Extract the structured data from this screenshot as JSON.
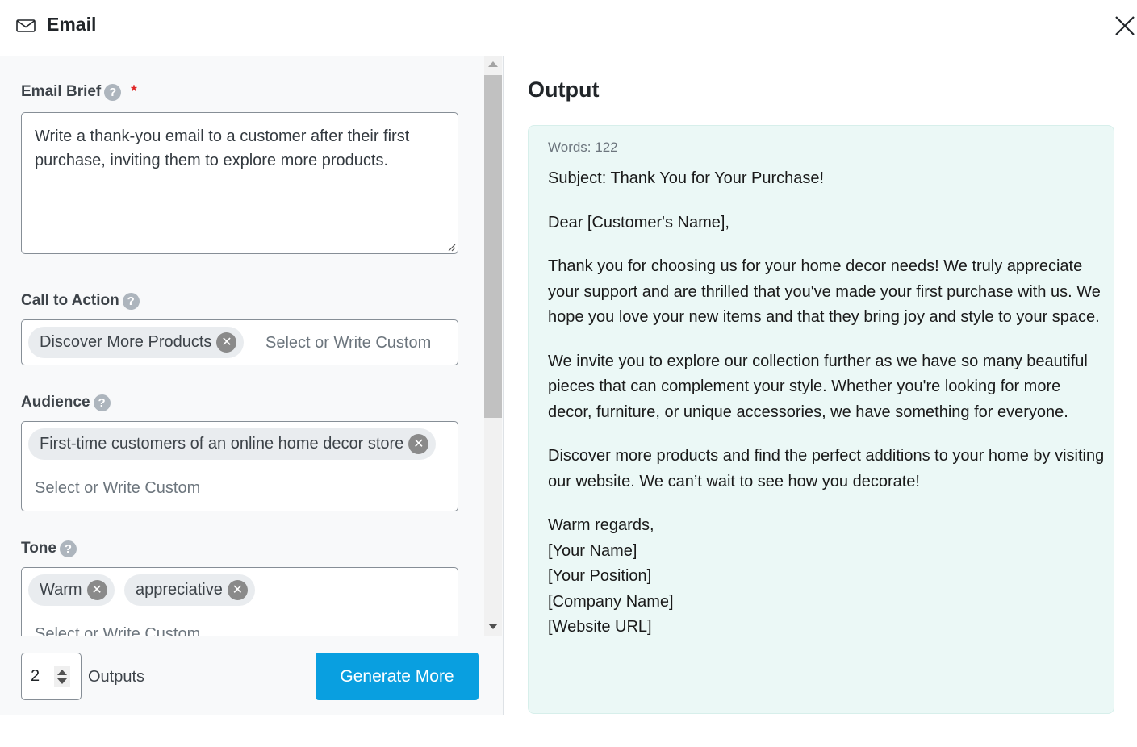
{
  "header": {
    "title": "Email",
    "icon": "mail-icon",
    "close_icon": "close-icon"
  },
  "form": {
    "email_brief": {
      "label": "Email Brief",
      "required_marker": "*",
      "help_glyph": "?",
      "value": "Write a thank-you email to a customer after their first purchase, inviting them to explore more products."
    },
    "call_to_action": {
      "label": "Call to Action",
      "help_glyph": "?",
      "tags": [
        "Discover More Products"
      ],
      "placeholder": "Select or Write Custom"
    },
    "audience": {
      "label": "Audience",
      "help_glyph": "?",
      "tags": [
        "First-time customers of an online home decor store"
      ],
      "placeholder": "Select or Write Custom"
    },
    "tone": {
      "label": "Tone",
      "help_glyph": "?",
      "tags": [
        "Warm",
        "appreciative"
      ],
      "placeholder": "Select or Write Custom"
    },
    "tag_remove_glyph": "✕"
  },
  "footer": {
    "outputs_value": "2",
    "outputs_label": "Outputs",
    "generate_label": "Generate More",
    "generate_color": "#099fe0"
  },
  "output": {
    "title": "Output",
    "words_label": "Words: 122",
    "paragraphs": [
      "Subject: Thank You for Your Purchase!",
      "Dear [Customer's Name],",
      "Thank you for choosing us for your home decor needs! We truly appreciate your support and are thrilled that you've made your first purchase with us. We hope you love your new items and that they bring joy and style to your space.",
      "We invite you to explore our collection further as we have so many beautiful pieces that can complement your style. Whether you're looking for more decor, furniture, or unique accessories, we have something for everyone.",
      "Discover more products and find the perfect additions to your home by visiting our website. We can’t wait to see how you decorate!"
    ],
    "signature": [
      "Warm regards,",
      "[Your Name]",
      "[Your Position]",
      "[Company Name]",
      "[Website URL]"
    ]
  }
}
